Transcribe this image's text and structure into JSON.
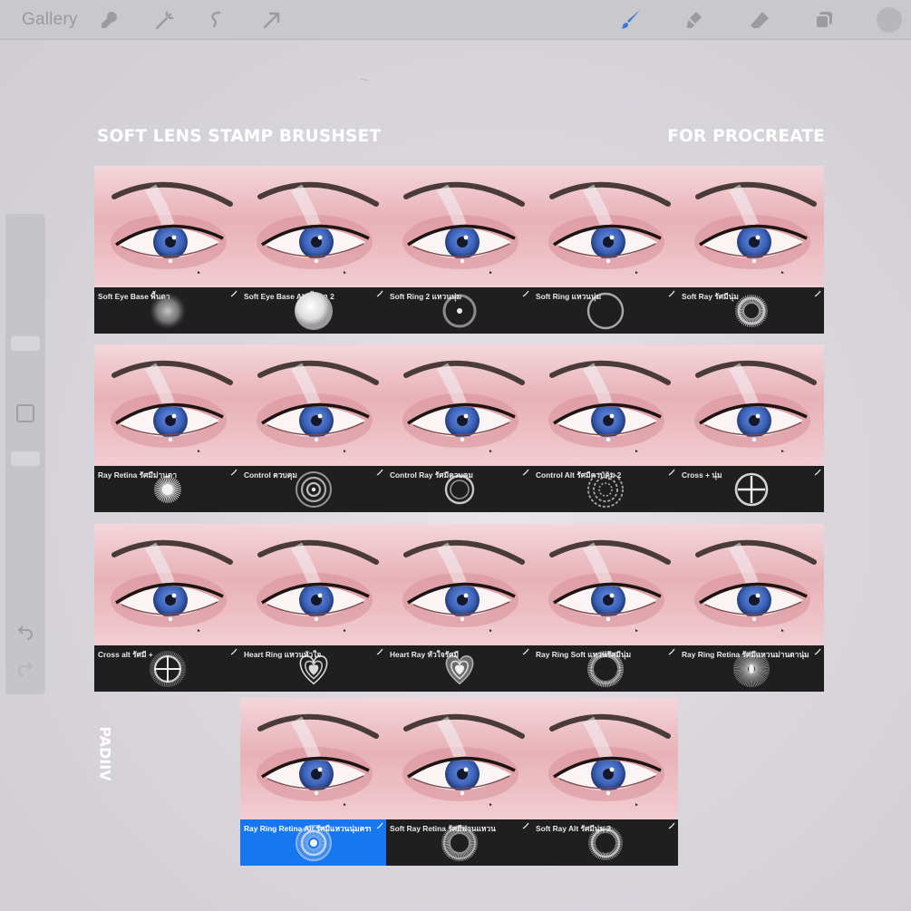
{
  "toolbar": {
    "gallery_label": "Gallery",
    "icons": [
      "wrench-icon",
      "magic-wand-icon",
      "selection-icon",
      "transform-arrow-icon",
      "brush-icon",
      "smudge-icon",
      "eraser-icon",
      "layers-icon",
      "color-icon"
    ]
  },
  "headings": {
    "left": "SOFT LENS STAMP BRUSHSET",
    "right": "FOR PROCREATE",
    "vertical": "PADIIV"
  },
  "colors": {
    "selected": "#1677f0",
    "card_bg": "#1f1f20",
    "iris": "#3b62b8",
    "skin": "#e9b7bd"
  },
  "brushes": [
    {
      "name": "Soft Eye Base พื้นตา",
      "preview": "soft-dot"
    },
    {
      "name": "Soft Eye Base Alt พื้นตา 2",
      "preview": "bright-dot"
    },
    {
      "name": "Soft Ring 2 แหวนนุ่ม",
      "preview": "soft-ring"
    },
    {
      "name": "Soft Ring แหวนนุ่ม",
      "preview": "thin-ring"
    },
    {
      "name": "Soft Ray รัศมีนุ่ม",
      "preview": "ray-ring"
    },
    {
      "name": "Ray Retina รัศมีม่านตา",
      "preview": "spiky"
    },
    {
      "name": "Control ควบคุม",
      "preview": "concentric"
    },
    {
      "name": "Control Ray รัศมีควบคุม",
      "preview": "double-ring"
    },
    {
      "name": "Control Alt รัศมีควบคุม 2",
      "preview": "dashed-rings"
    },
    {
      "name": "Cross + นุ่ม",
      "preview": "cross"
    },
    {
      "name": "Cross alt รัศมี +",
      "preview": "cross-alt"
    },
    {
      "name": "Heart Ring แหวนหัวใจ",
      "preview": "heart"
    },
    {
      "name": "Heart Ray หัวใจรัศมี",
      "preview": "heart-ray"
    },
    {
      "name": "Ray Ring Soft แหวนรัศมีนุ่ม",
      "preview": "ray-ring-soft"
    },
    {
      "name": "Ray Ring Retina รัศมีแหวนม่านตานุ่ม",
      "preview": "ray-retina"
    },
    {
      "name": "Ray Ring Retina Alt รัศมีแหวนนุ่มครบเซต",
      "preview": "blue-ring",
      "selected": true
    },
    {
      "name": "Soft Ray Retina รัศมีม่านแหวน",
      "preview": "soft-ray-retina"
    },
    {
      "name": "Soft Ray Alt รัศมีนุ่ม 2",
      "preview": "soft-ray-alt"
    }
  ]
}
